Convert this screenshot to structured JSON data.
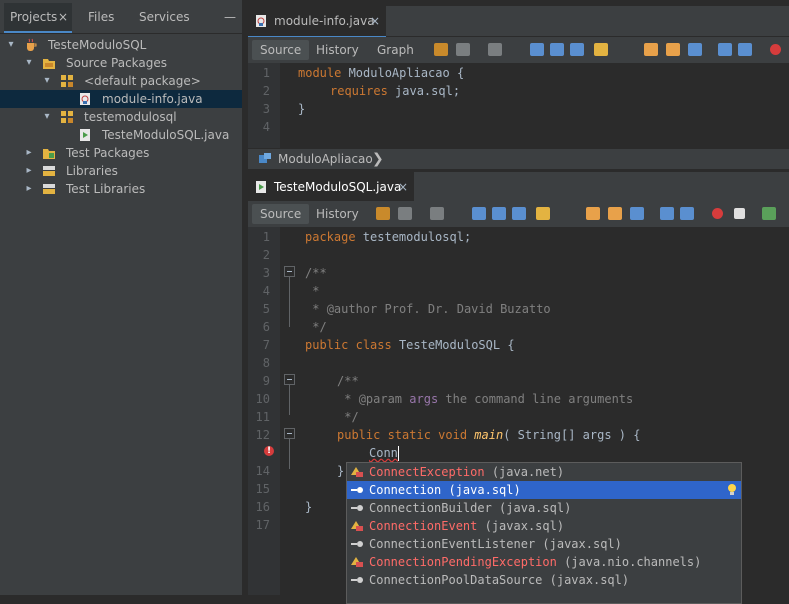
{
  "left_panel": {
    "tabs": [
      {
        "label": "Projects",
        "close": "×",
        "active": true
      },
      {
        "label": "Files",
        "active": false
      },
      {
        "label": "Services",
        "active": false
      }
    ],
    "minimize": "—",
    "tree": [
      {
        "label": "TesteModuloSQL",
        "icon": "java-project-icon",
        "expand": "▾"
      },
      {
        "label": "Source Packages",
        "icon": "source-packages-icon",
        "expand": "▾"
      },
      {
        "label": "<default package>",
        "icon": "package-icon",
        "expand": "▾"
      },
      {
        "label": "module-info.java",
        "icon": "module-file-icon",
        "selected": true
      },
      {
        "label": "testemodulosql",
        "icon": "package-icon",
        "expand": "▾"
      },
      {
        "label": "TesteModuloSQL.java",
        "icon": "java-file-icon"
      },
      {
        "label": "Test Packages",
        "icon": "folder-icon",
        "expand": "▸"
      },
      {
        "label": "Libraries",
        "icon": "libraries-icon",
        "expand": "▸"
      },
      {
        "label": "Test Libraries",
        "icon": "libraries-icon",
        "expand": "▸"
      }
    ]
  },
  "editor1": {
    "tab": {
      "label": "module-info.java",
      "close": "×",
      "icon": "module-file-icon"
    },
    "toolbar": {
      "source": "Source",
      "history": "History",
      "graph": "Graph"
    },
    "line_numbers": [
      "1",
      "2",
      "3",
      "4"
    ],
    "code": {
      "line1_kw": "module",
      "line1_rest": " ModuloApliacao {",
      "line2_kw": "requires",
      "line2_rest": " java.sql;",
      "line3": "}"
    },
    "breadcrumb": {
      "label": "ModuloApliacao",
      "sep": "❯",
      "icon": "module-icon"
    }
  },
  "editor2": {
    "tab": {
      "label": "TesteModuloSQL.java",
      "close": "×",
      "icon": "java-file-icon"
    },
    "toolbar": {
      "source": "Source",
      "history": "History"
    },
    "line_numbers": [
      "1",
      "2",
      "3",
      "4",
      "5",
      "6",
      "7",
      "8",
      "9",
      "10",
      "11",
      "12",
      "",
      "14",
      "15",
      "16",
      "17"
    ],
    "error_marker": "!",
    "code": {
      "l1_kw": "package",
      "l1_rest": " testemodulosql;",
      "l3": "/**",
      "l4": " *",
      "l5_a": " * ",
      "l5_tag": "@author",
      "l5_b": " Prof. Dr. David Buzatto",
      "l6": " */",
      "l7_kw1": "public",
      "l7_kw2": "class",
      "l7_rest": " TesteModuloSQL {",
      "l9": "/**",
      "l10_a": " * ",
      "l10_tag": "@param",
      "l10_arg": " args",
      "l10_b": " the command line arguments",
      "l11": " */",
      "l12_kw": "public static void",
      "l12_fn": "main",
      "l12_rest": "( String[] args ) {",
      "l13": "Conn",
      "l14": "}",
      "l16": "}"
    }
  },
  "completion": {
    "items": [
      {
        "name": "ConnectException",
        "pkg": " (java.net)",
        "icon": "exception-class-icon",
        "deprecated": true
      },
      {
        "name": "Connection",
        "pkg": " (java.sql)",
        "icon": "interface-icon",
        "selected": true
      },
      {
        "name": "ConnectionBuilder",
        "pkg": " (java.sql)",
        "icon": "interface-icon"
      },
      {
        "name": "ConnectionEvent",
        "pkg": " (javax.sql)",
        "icon": "exception-class-icon",
        "deprecated": true
      },
      {
        "name": "ConnectionEventListener",
        "pkg": " (javax.sql)",
        "icon": "interface-icon"
      },
      {
        "name": "ConnectionPendingException",
        "pkg": " (java.nio.channels)",
        "icon": "exception-class-icon",
        "deprecated": true
      },
      {
        "name": "ConnectionPoolDataSource",
        "pkg": " (javax.sql)",
        "icon": "interface-icon"
      }
    ],
    "hint_icon": "lightbulb-icon"
  },
  "colors": {
    "background": "#2b2b2b",
    "panel": "#3c3f41",
    "keyword": "#cc7832",
    "comment": "#808080",
    "selection": "#2f65ca",
    "error": "#ff6b68"
  }
}
